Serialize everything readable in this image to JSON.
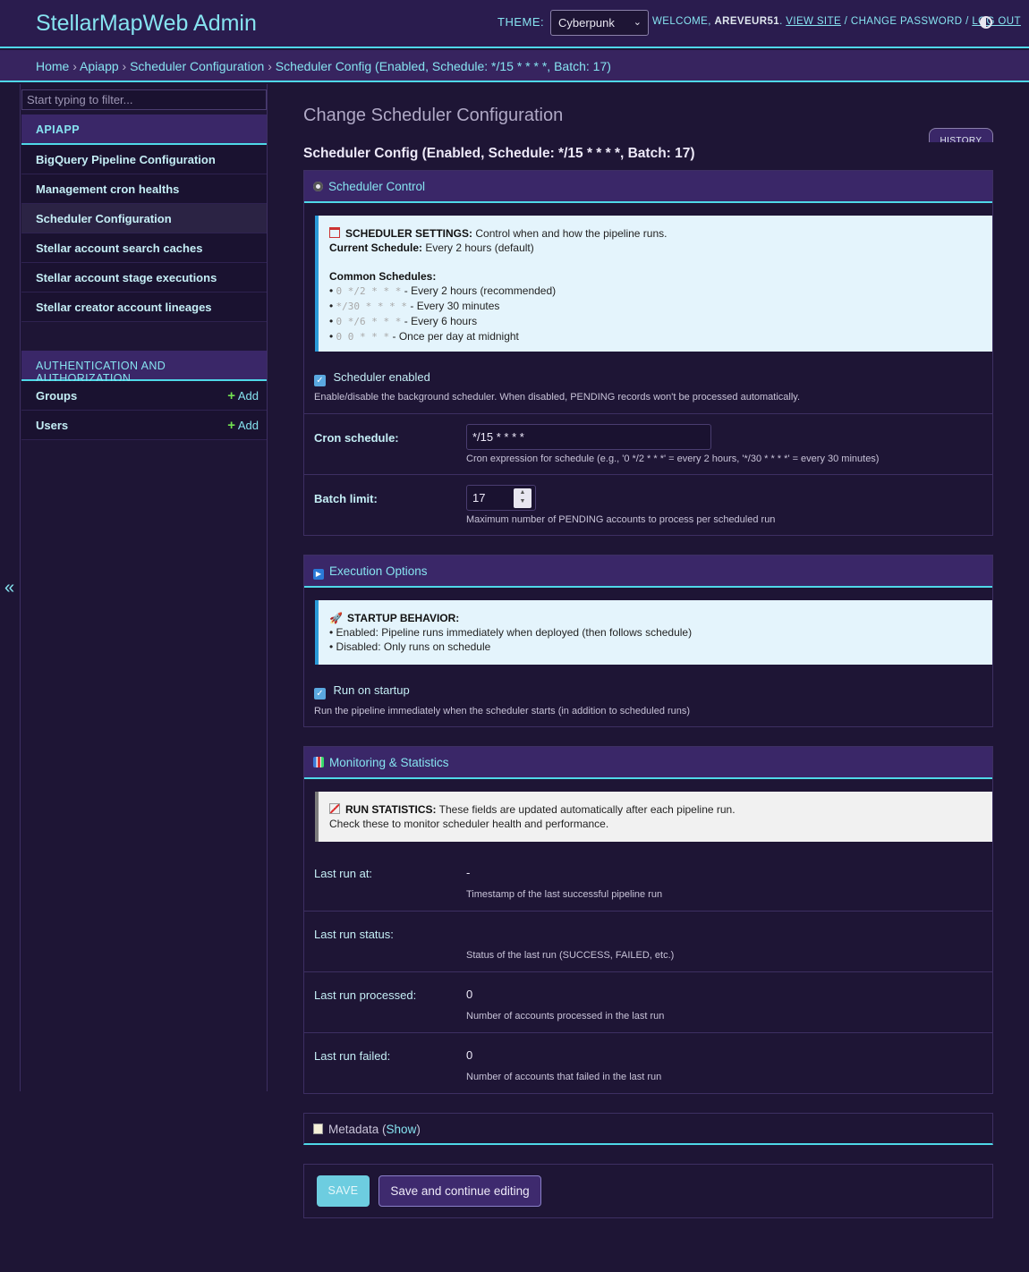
{
  "header": {
    "brand": "StellarMapWeb Admin",
    "theme_label": "THEME:",
    "theme_value": "Cyberpunk",
    "welcome": "WELCOME,",
    "username": "AREVEUR51",
    "view_site": "VIEW SITE",
    "change_password": "CHANGE PASSWORD",
    "log_out": "LOG OUT",
    "sep1": ".",
    "sep2": "/",
    "sep3": "/"
  },
  "breadcrumbs": {
    "home": "Home",
    "app": "Apiapp",
    "model": "Scheduler Configuration",
    "object": "Scheduler Config (Enabled, Schedule: */15 * * * *, Batch: 17)",
    "sep": "›"
  },
  "sidebar": {
    "filter_placeholder": "Start typing to filter...",
    "apiapp_caption": "APIAPP",
    "apiapp_items": [
      {
        "label": "BigQuery Pipeline Configuration"
      },
      {
        "label": "Management cron healths"
      },
      {
        "label": "Scheduler Configuration"
      },
      {
        "label": "Stellar account search caches"
      },
      {
        "label": "Stellar account stage executions"
      },
      {
        "label": "Stellar creator account lineages"
      }
    ],
    "auth_caption": "AUTHENTICATION AND AUTHORIZATION",
    "auth_items": [
      {
        "label": "Groups",
        "add": "Add"
      },
      {
        "label": "Users",
        "add": "Add"
      }
    ],
    "collapse_icon": "«"
  },
  "main": {
    "page_title": "Change Scheduler Configuration",
    "history": "HISTORY",
    "object_title": "Scheduler Config (Enabled, Schedule: */15 * * * *, Batch: 17)"
  },
  "scheduler_control": {
    "title": "Scheduler Control",
    "icon": "gear-icon",
    "settings_bold": "SCHEDULER SETTINGS:",
    "settings_text": " Control when and how the pipeline runs.",
    "current_bold": "Current Schedule:",
    "current_text": " Every 2 hours (default)",
    "common_bold": "Common Schedules:",
    "schedules": [
      {
        "cron": "0 */2 * * *",
        "text": " - Every 2 hours (recommended)"
      },
      {
        "cron": "*/30 * * * *",
        "text": " - Every 30 minutes"
      },
      {
        "cron": "0 */6 * * *",
        "text": " - Every 6 hours"
      },
      {
        "cron": "0 0 * * *",
        "text": " - Once per day at midnight"
      }
    ],
    "enabled_label": "Scheduler enabled",
    "enabled_help": "Enable/disable the background scheduler. When disabled, PENDING records won't be processed automatically.",
    "cron_label": "Cron schedule:",
    "cron_value": "*/15 * * * *",
    "cron_help": "Cron expression for schedule (e.g., '0 */2 * * *' = every 2 hours, '*/30 * * * *' = every 30 minutes)",
    "batch_label": "Batch limit:",
    "batch_value": "17",
    "batch_help": "Maximum number of PENDING accounts to process per scheduled run"
  },
  "execution_options": {
    "title": "Execution Options",
    "icon": "play-icon",
    "startup_bold": "STARTUP BEHAVIOR:",
    "line1": "• Enabled: Pipeline runs immediately when deployed (then follows schedule)",
    "line2": "• Disabled: Only runs on schedule",
    "run_label": "Run on startup",
    "run_help": "Run the pipeline immediately when the scheduler starts (in addition to scheduled runs)"
  },
  "monitoring": {
    "title": "Monitoring & Statistics",
    "icon": "bar-chart-icon",
    "stats_bold": "RUN STATISTICS:",
    "stats_text": " These fields are updated automatically after each pipeline run.",
    "stats_line2": "Check these to monitor scheduler health and performance.",
    "fields": [
      {
        "label": "Last run at:",
        "value": "-",
        "help": "Timestamp of the last successful pipeline run"
      },
      {
        "label": "Last run status:",
        "value": "",
        "help": "Status of the last run (SUCCESS, FAILED, etc.)"
      },
      {
        "label": "Last run processed:",
        "value": "0",
        "help": "Number of accounts processed in the last run"
      },
      {
        "label": "Last run failed:",
        "value": "0",
        "help": "Number of accounts that failed in the last run"
      }
    ]
  },
  "metadata": {
    "title": "Metadata",
    "paren_open": " (",
    "show": "Show",
    "paren_close": ")",
    "icon": "memo-icon"
  },
  "submit": {
    "save": "SAVE",
    "save_continue": "Save and continue editing"
  },
  "colors": {
    "accent": "#4fd8e8",
    "header_bg": "#2a1c4e",
    "panel_bg": "#3a2768",
    "page_bg": "#1e1535"
  }
}
